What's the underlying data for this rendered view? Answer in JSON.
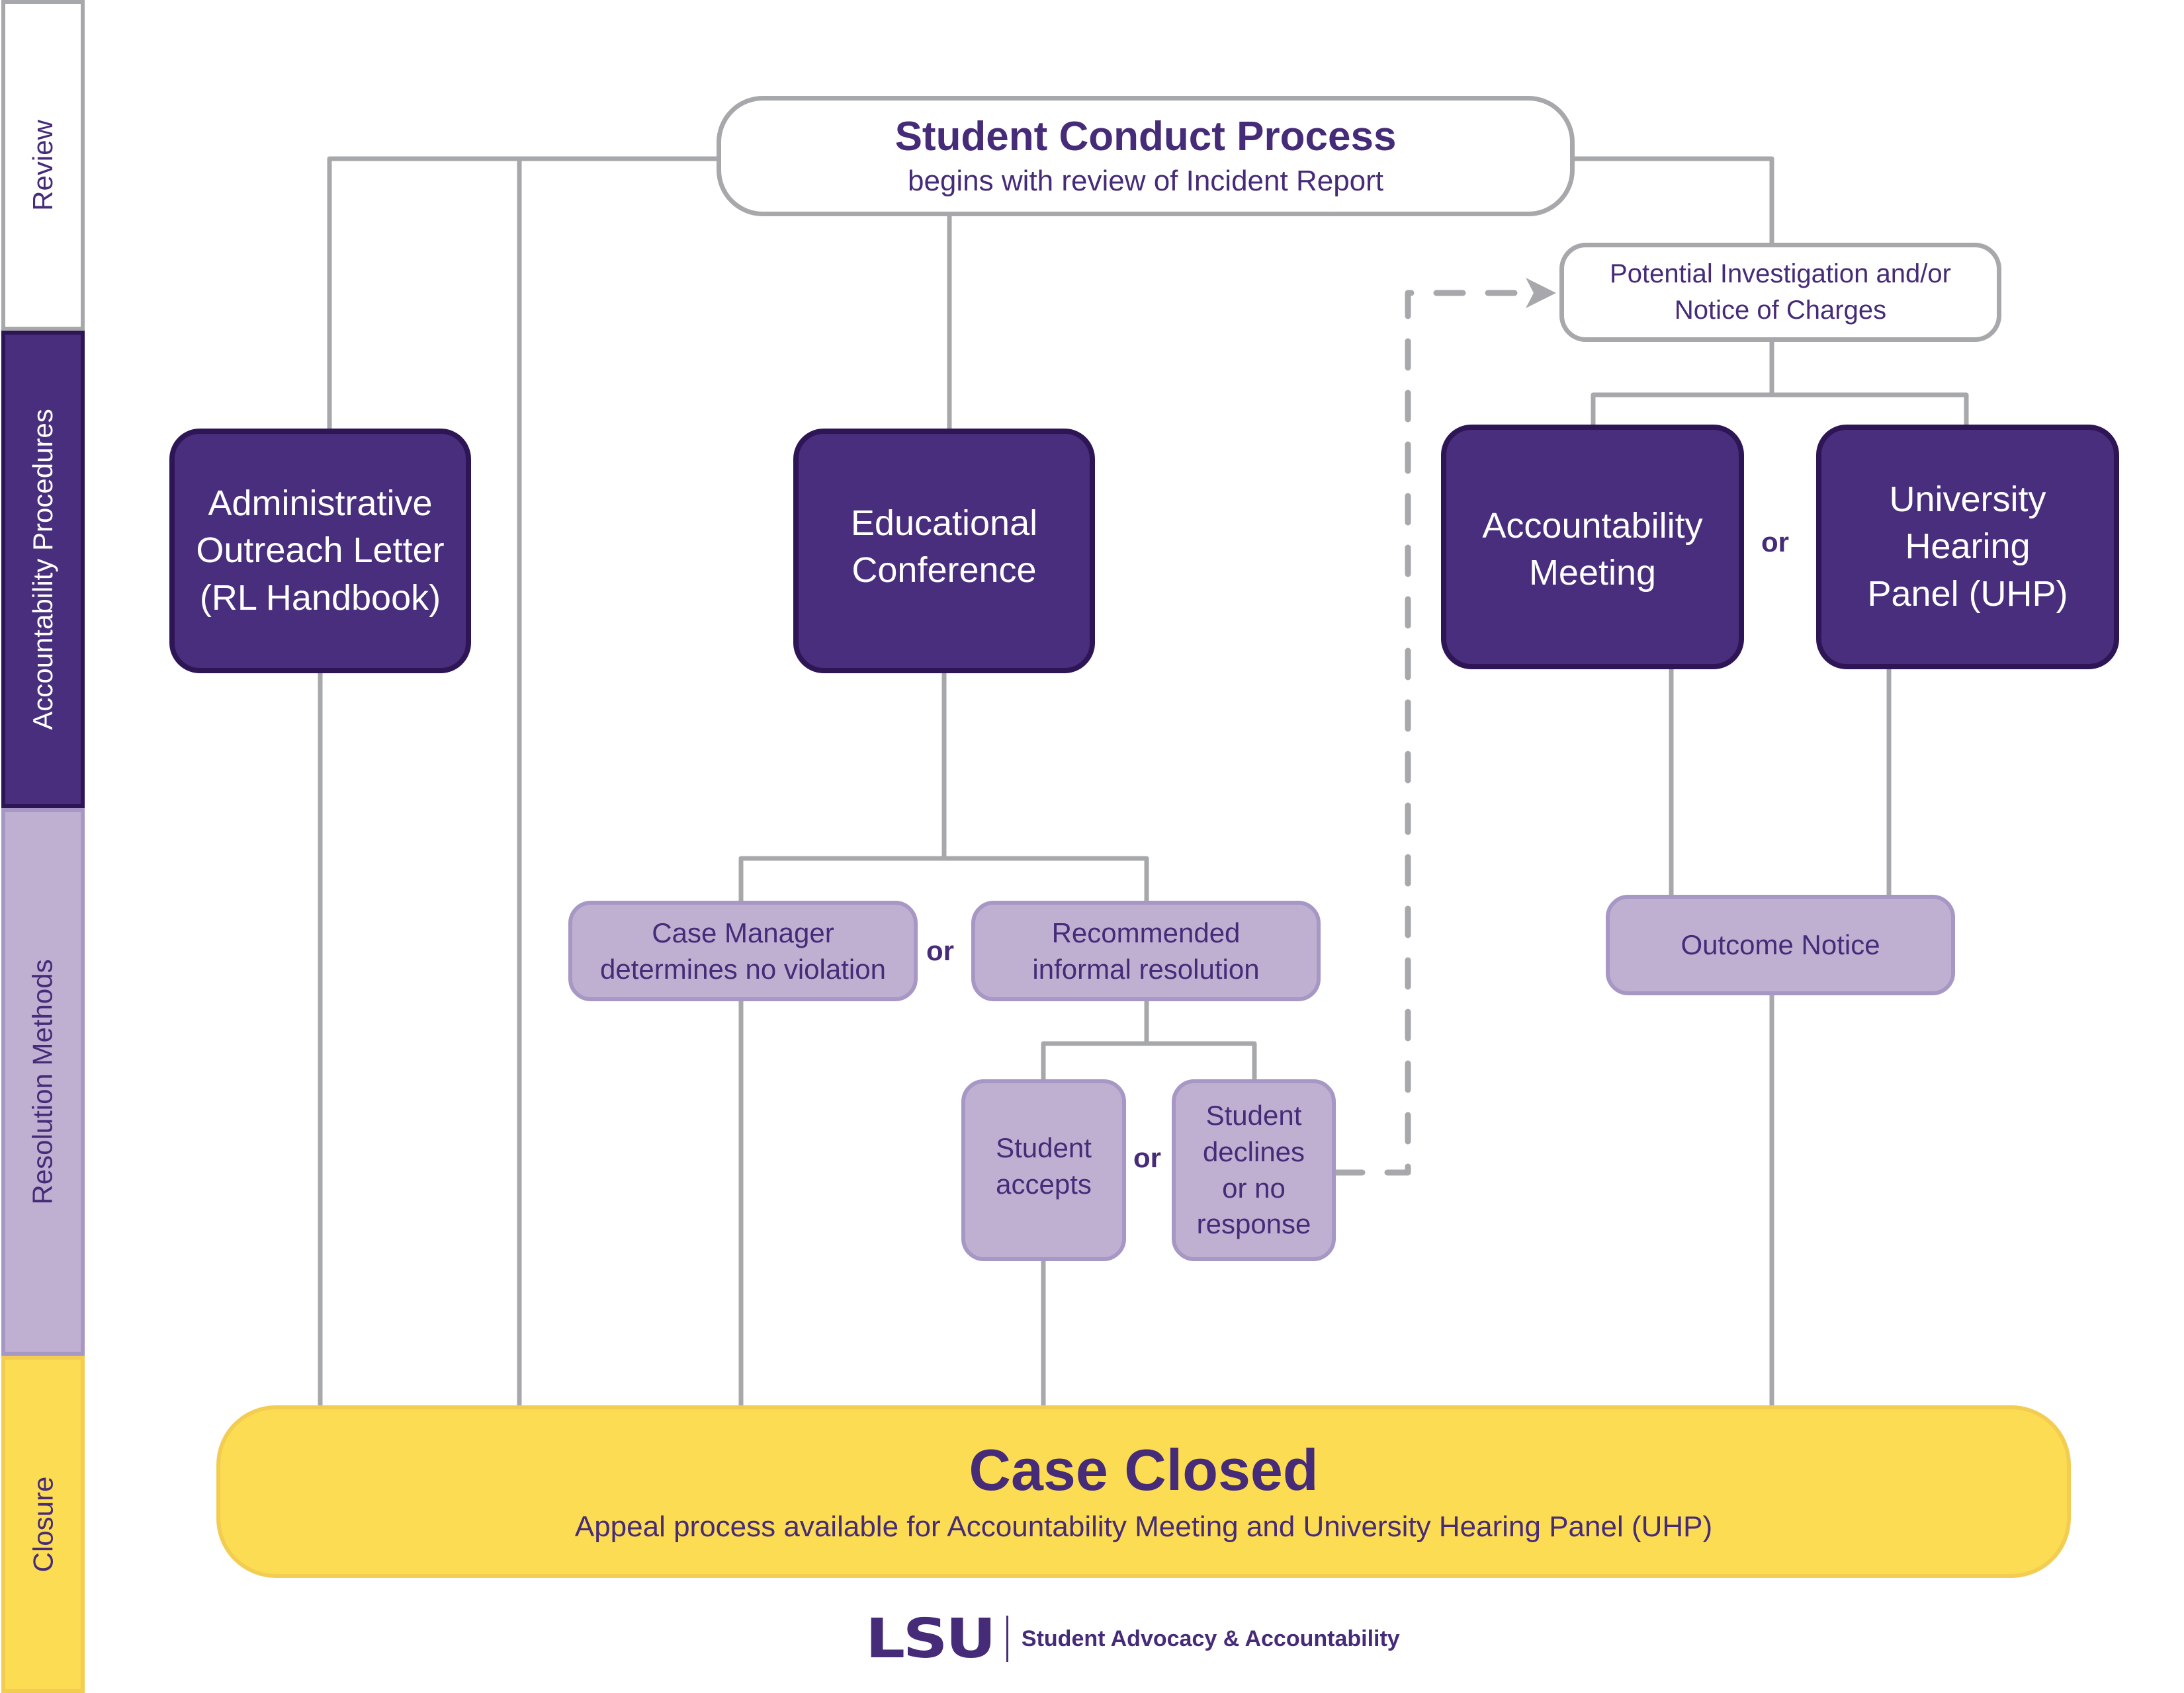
{
  "sidebar": {
    "stages": [
      {
        "label": "Review"
      },
      {
        "label": "Accountability Procedures"
      },
      {
        "label": "Resolution Methods"
      },
      {
        "label": "Closure"
      }
    ]
  },
  "nodes": {
    "start": {
      "title": "Student Conduct Process",
      "subtitle": "begins with review of Incident Report"
    },
    "investigation": {
      "lines": [
        "Potential Investigation and/or",
        "Notice of Charges"
      ]
    },
    "admin_letter": {
      "lines": [
        "Administrative",
        "Outreach Letter",
        "(RL Handbook)"
      ]
    },
    "educational_conference": {
      "lines": [
        "Educational",
        "Conference"
      ]
    },
    "accountability_meeting": {
      "lines": [
        "Accountability",
        "Meeting"
      ]
    },
    "uhp": {
      "lines": [
        "University",
        "Hearing",
        "Panel (UHP)"
      ]
    },
    "no_violation": {
      "lines": [
        "Case Manager",
        "determines no violation"
      ]
    },
    "informal_resolution": {
      "lines": [
        "Recommended",
        "informal resolution"
      ]
    },
    "student_accepts": {
      "lines": [
        "Student",
        "accepts"
      ]
    },
    "student_declines": {
      "lines": [
        "Student",
        "declines",
        "or no",
        "response"
      ]
    },
    "outcome_notice": {
      "label": "Outcome Notice"
    },
    "case_closed": {
      "title": "Case Closed",
      "subtitle": "Appeal process available for Accountability Meeting and University Hearing Panel (UHP)"
    }
  },
  "connectors": {
    "or_label": "or"
  },
  "footer": {
    "logo": "LSU",
    "department": "Student Advocacy & Accountability"
  },
  "colors": {
    "dark_purple": "#482e7c",
    "dark_border": "#2e1656",
    "light_purple": "#bfb0d2",
    "light_border": "#a697c4",
    "gold": "#fcdc52",
    "gray_line": "#a7a8ab",
    "text_purple": "#462b78"
  }
}
